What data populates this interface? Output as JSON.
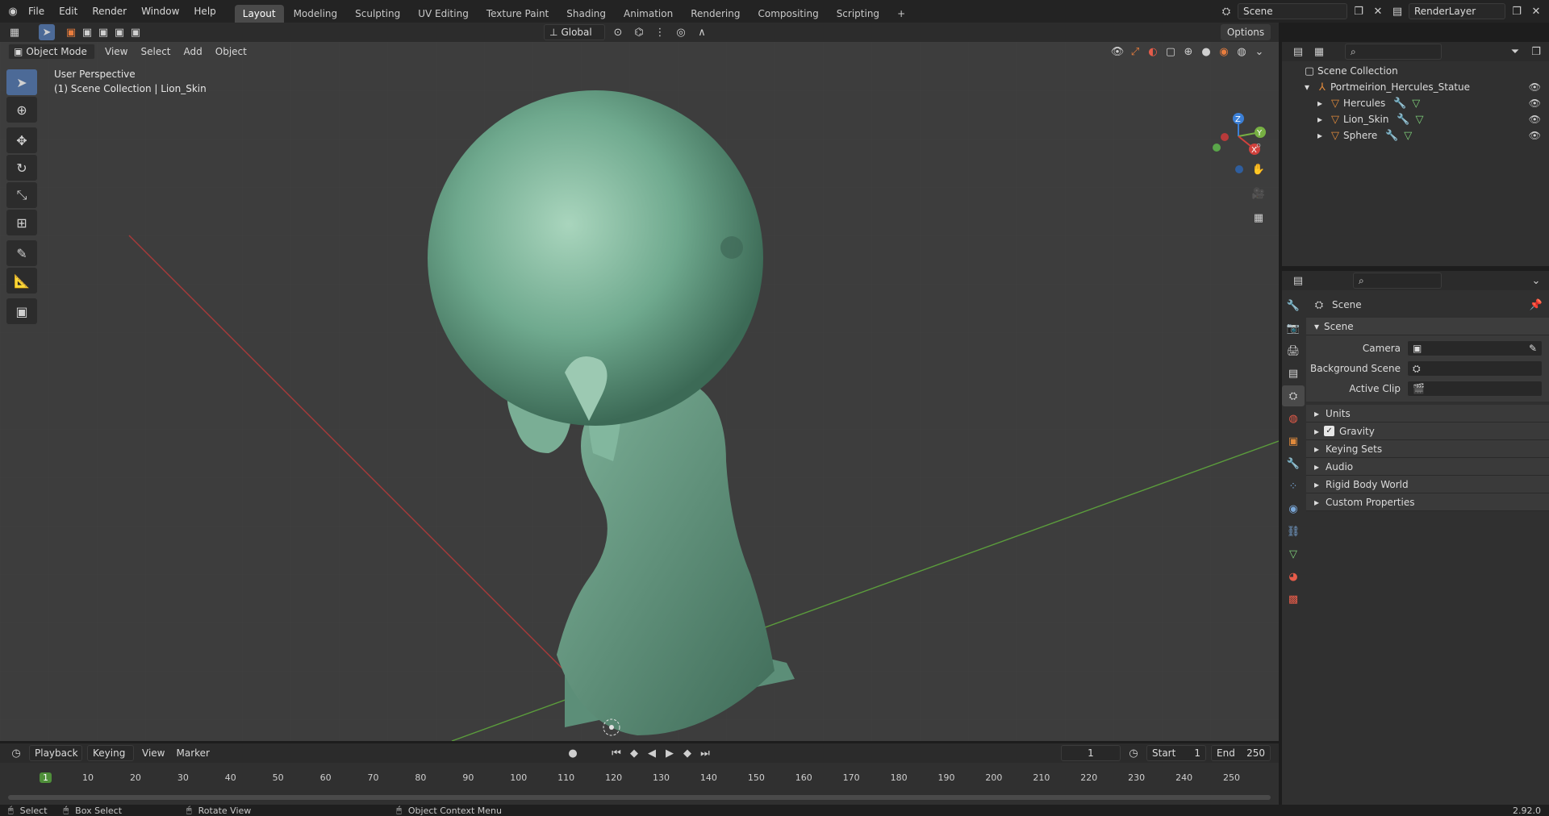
{
  "menu": {
    "file": "File",
    "edit": "Edit",
    "render": "Render",
    "window": "Window",
    "help": "Help"
  },
  "workspaces": [
    "Layout",
    "Modeling",
    "Sculpting",
    "UV Editing",
    "Texture Paint",
    "Shading",
    "Animation",
    "Rendering",
    "Compositing",
    "Scripting"
  ],
  "top_right": {
    "scene": "Scene",
    "view_layer": "RenderLayer"
  },
  "header": {
    "mode": "Object Mode",
    "view": "View",
    "select": "Select",
    "add": "Add",
    "object": "Object",
    "orientation": "Global",
    "options": "Options"
  },
  "viewport": {
    "line1": "User Perspective",
    "line2": "(1) Scene Collection | Lion_Skin"
  },
  "outliner": {
    "collection": "Scene Collection",
    "object_parent": "Portmeirion_Hercules_Statue",
    "children": [
      "Hercules",
      "Lion_Skin",
      "Sphere"
    ]
  },
  "properties": {
    "breadcrumb": "Scene",
    "panel_title": "Scene",
    "camera_label": "Camera",
    "background_label": "Background Scene",
    "active_clip_label": "Active Clip",
    "sections": [
      "Units",
      "Gravity",
      "Keying Sets",
      "Audio",
      "Rigid Body World",
      "Custom Properties"
    ]
  },
  "timeline": {
    "playback": "Playback",
    "keying": "Keying",
    "view": "View",
    "marker": "Marker",
    "current_frame": "1",
    "start_label": "Start",
    "start_value": "1",
    "end_label": "End",
    "end_value": "250",
    "ticks": [
      "1",
      "10",
      "20",
      "30",
      "40",
      "50",
      "60",
      "70",
      "80",
      "90",
      "100",
      "110",
      "120",
      "130",
      "140",
      "150",
      "160",
      "170",
      "180",
      "190",
      "200",
      "210",
      "220",
      "230",
      "240",
      "250"
    ]
  },
  "status": {
    "select": "Select",
    "box_select": "Box Select",
    "rotate_view": "Rotate View",
    "context_menu": "Object Context Menu",
    "version": "2.92.0"
  }
}
